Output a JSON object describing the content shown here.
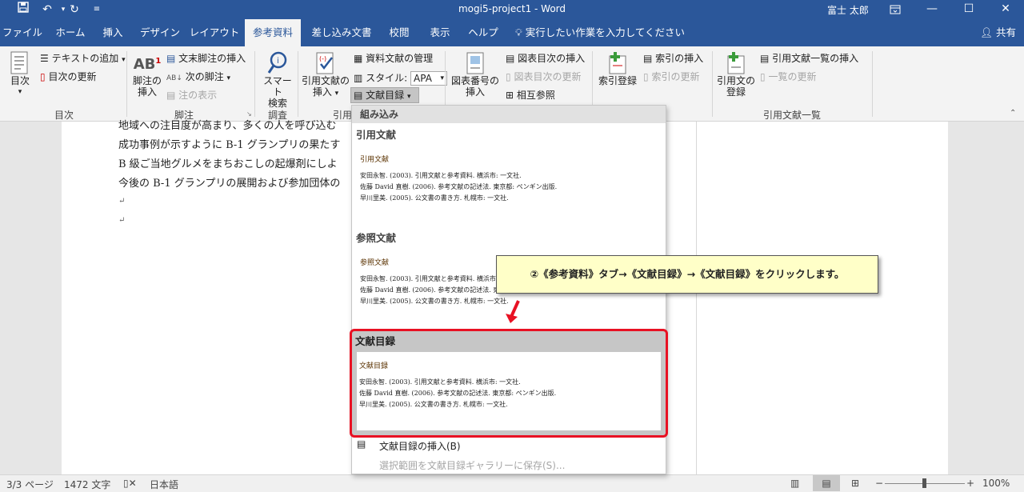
{
  "titlebar": {
    "title": "mogi5-project1  -  Word",
    "user": "富士 太郎",
    "save_icon": "save-icon",
    "undo_icon": "undo-icon",
    "redo_icon": "redo-icon"
  },
  "tabs": [
    "ファイル",
    "ホーム",
    "挿入",
    "デザイン",
    "レイアウト",
    "参考資料",
    "差し込み文書",
    "校閲",
    "表示",
    "ヘルプ"
  ],
  "tellme": "実行したい作業を入力してください",
  "share": "共有",
  "ribbon": {
    "toc": {
      "big": "目次",
      "add_text": "テキストの追加",
      "update": "目次の更新",
      "group": "目次"
    },
    "footnotes": {
      "insert_line1": "脚注の",
      "insert_line2": "挿入",
      "endnote": "文末脚注の挿入",
      "next": "次の脚注",
      "show": "注の表示",
      "group": "脚注",
      "ab_glyph": "AB"
    },
    "research": {
      "line1": "スマート",
      "line2": "検索",
      "group": "調査"
    },
    "citations": {
      "insert_line1": "引用文献の",
      "insert_line2": "挿入",
      "manage": "資料文献の管理",
      "style_label": "スタイル:",
      "style_value": "APA",
      "biblio": "文献目録",
      "group": "引用"
    },
    "captions": {
      "insert_line1": "図表番号の",
      "insert_line2": "挿入",
      "tof": "図表目次の挿入",
      "tof_update": "図表目次の更新",
      "crossref": "相互参照"
    },
    "index": {
      "mark": "索引登録",
      "insert": "索引の挿入",
      "update": "索引の更新"
    },
    "toa": {
      "mark_line1": "引用文の",
      "mark_line2": "登録",
      "insert": "引用文献一覧の挿入",
      "update": "一覧の更新",
      "group": "引用文献一覧"
    }
  },
  "document": {
    "lines": [
      "地域への注目度が高まり、多くの人を呼び込む",
      "成功事例が示すように B-1 グランプリの果たす",
      "B 級ご当地グルメをまちおこしの起爆剤にしよ",
      "今後の B-1 グランプリの展開および参加団体の"
    ],
    "para_mark": "↵"
  },
  "dropdown": {
    "header": "組み込み",
    "sections": [
      {
        "name": "引用文献",
        "preview_title": "引用文献"
      },
      {
        "name": "参照文献",
        "preview_title": "参照文献"
      },
      {
        "name": "文献目録",
        "preview_title": "文献目録"
      }
    ],
    "entries": [
      "安田永智. (2003). 引用文献と参考資料. 横浜市: 一文社.",
      "佐藤 David 直樹. (2006). 参考文献の記述法. 東京都: ペンギン出版.",
      "早川里美. (2005). 公文書の書き方. 札幌市: 一文社."
    ],
    "cmd_insert": "文献目録の挿入(B)",
    "cmd_save": "選択範囲を文献目録ギャラリーに保存(S)..."
  },
  "callout": "②《参考資料》タブ→《文献目録》→《文献目録》をクリックします。",
  "statusbar": {
    "page": "3/3 ページ",
    "words": "1472 文字",
    "lang": "日本語",
    "zoom": "100%"
  },
  "colors": {
    "title_blue": "#2b579a",
    "highlight_red": "#e81123",
    "callout_bg": "#ffffc8"
  }
}
